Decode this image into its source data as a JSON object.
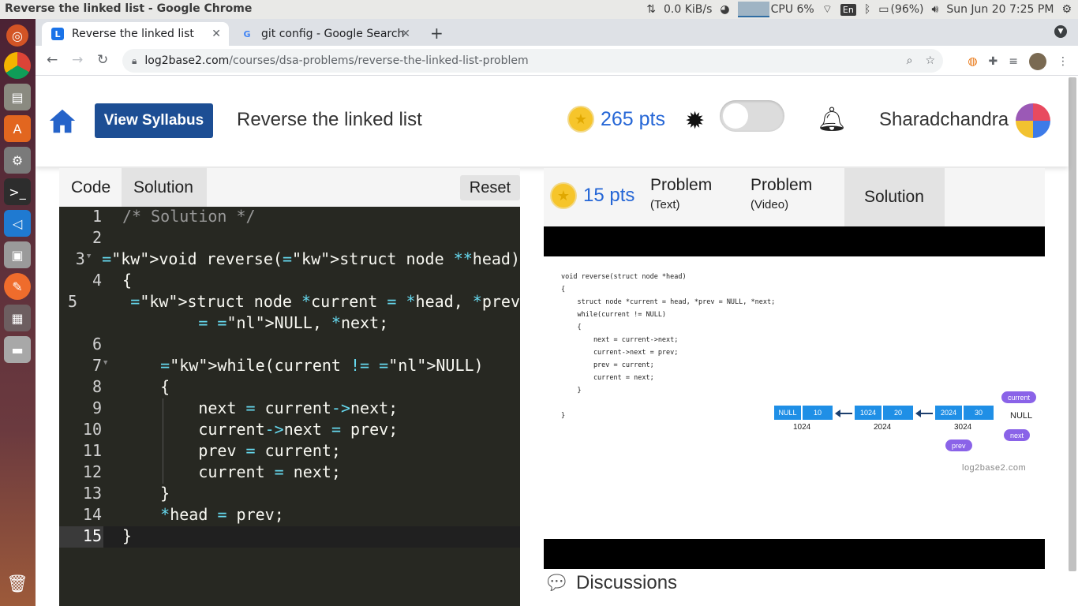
{
  "os": {
    "window_title": "Reverse the linked list - Google Chrome",
    "network": "0.0 KiB/s",
    "cpu": "CPU 6%",
    "keyboard": "En",
    "battery": "(96%)",
    "clock": "Sun Jun 20  7:25 PM"
  },
  "browser": {
    "tabs": [
      {
        "label": "Reverse the linked list",
        "active": true
      },
      {
        "label": "git config - Google Search",
        "active": false
      }
    ],
    "url_host": "log2base2.com",
    "url_path": "/courses/dsa-problems/reverse-the-linked-list-problem"
  },
  "header": {
    "syllabus_label": "View Syllabus",
    "page_title": "Reverse the linked list",
    "points": "265 pts",
    "username": "Sharadchandra"
  },
  "left": {
    "tabs": [
      "Code",
      "Solution"
    ],
    "reset_label": "Reset",
    "code_lines": [
      "/* Solution */",
      "",
      "void reverse(struct node **head)",
      "{",
      "    struct node *current = *head, *prev",
      "        = NULL, *next;",
      "",
      "    while(current != NULL)",
      "    {",
      "        next = current->next;",
      "        current->next = prev;",
      "        prev = current;",
      "        current = next;",
      "    }",
      "    *head = prev;",
      "}"
    ]
  },
  "right": {
    "points": "15 pts",
    "tabs": [
      {
        "label": "Problem",
        "sub": "(Text)"
      },
      {
        "label": "Problem",
        "sub": "(Video)"
      },
      {
        "label": "Solution",
        "sub": ""
      }
    ],
    "video_code": "void reverse(struct node *head)\n{\n    struct node *current = head, *prev = NULL, *next;\n    while(current != NULL)\n    {\n        next = current->next;\n        current->next = prev;\n        prev = current;\n        current = next;\n    }\n\n}",
    "nodes": [
      {
        "ptr": "NULL",
        "val": "10",
        "addr": "1024"
      },
      {
        "ptr": "1024",
        "val": "20",
        "addr": "2024"
      },
      {
        "ptr": "2024",
        "val": "30",
        "addr": "3024"
      }
    ],
    "pill_current": "current",
    "pill_next": "next",
    "pill_prev": "prev",
    "null_label": "NULL",
    "brand": "log2base2.com",
    "discussions": "Discussions"
  }
}
